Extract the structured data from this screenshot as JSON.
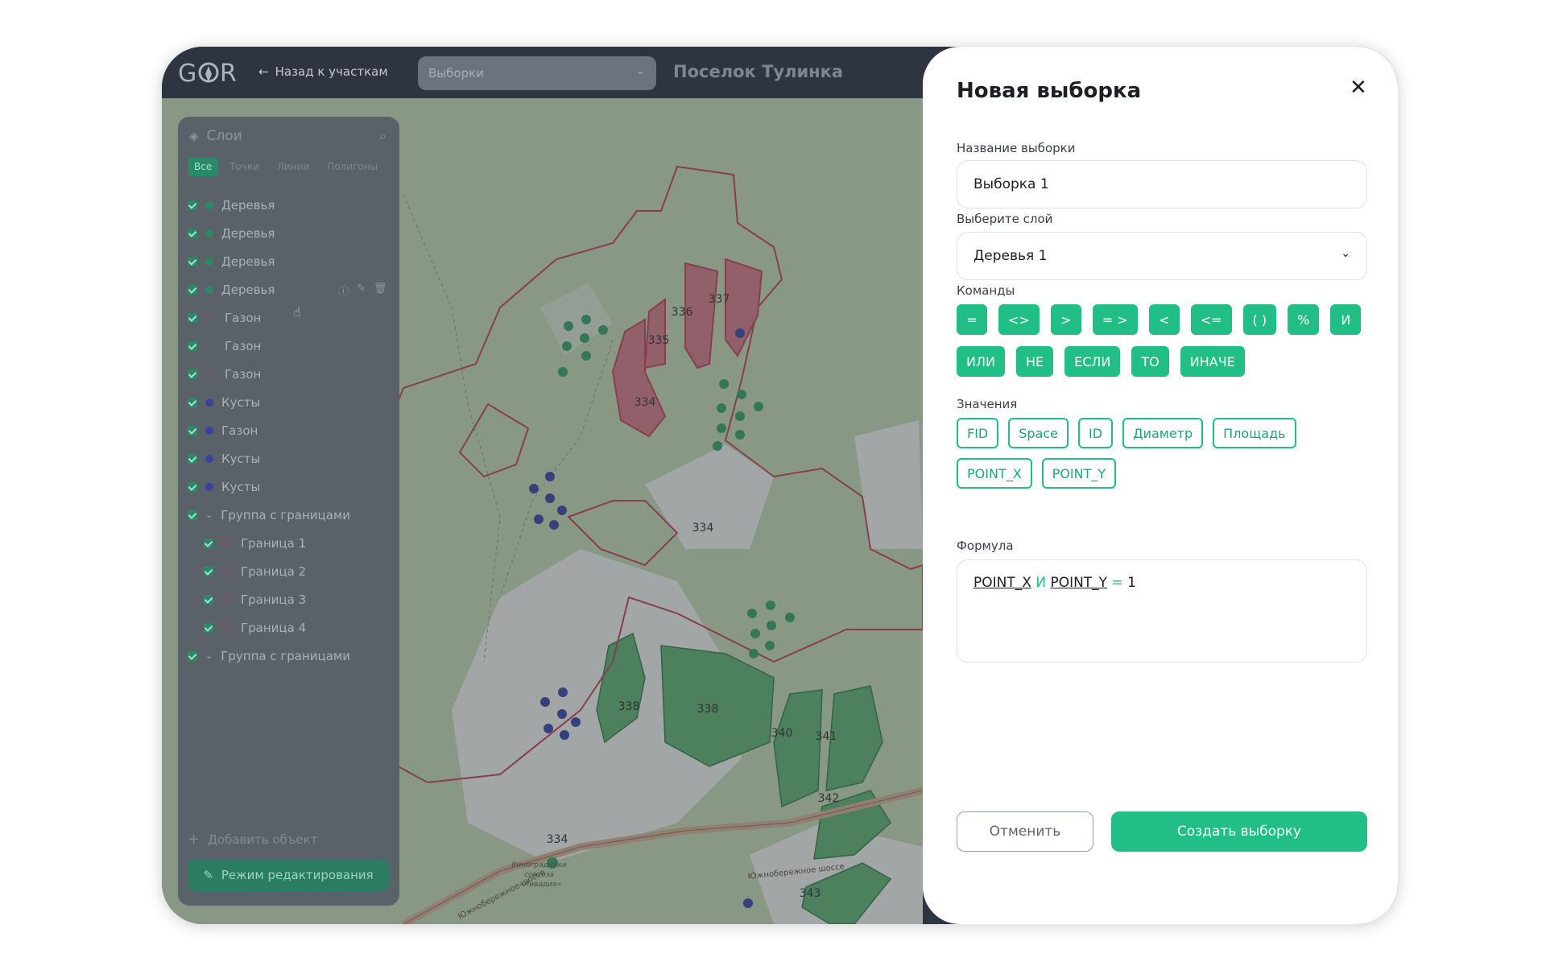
{
  "header": {
    "back_label": "Назад к участкам",
    "selector_value": "Выборки",
    "place_title": "Поселок Тулинка"
  },
  "map": {
    "plot_labels": [
      "337",
      "336",
      "335",
      "334",
      "334",
      "338",
      "338",
      "340",
      "341",
      "342",
      "343",
      "334"
    ],
    "road_label": "Южнобережное шоссе",
    "place_label": "Виноградники совхоза «Ливадия»",
    "road_label_2": "Южнобережное шоссе"
  },
  "layers": {
    "title": "Слои",
    "filters": [
      "Все",
      "Точки",
      "Линии",
      "Полигоны"
    ],
    "items": [
      {
        "label": "Деревья",
        "marker": "green"
      },
      {
        "label": "Деревья",
        "marker": "green"
      },
      {
        "label": "Деревья",
        "marker": "green"
      },
      {
        "label": "Деревья",
        "marker": "green"
      },
      {
        "label": "Газон",
        "marker": "line"
      },
      {
        "label": "Газон",
        "marker": "line"
      },
      {
        "label": "Газон",
        "marker": "line"
      },
      {
        "label": "Кусты",
        "marker": "blue"
      },
      {
        "label": "Газон",
        "marker": "blue"
      },
      {
        "label": "Кусты",
        "marker": "blue"
      },
      {
        "label": "Кусты",
        "marker": "blue"
      },
      {
        "label": "Группа с границами",
        "marker": "group"
      },
      {
        "label": "Граница 1",
        "marker": "poly"
      },
      {
        "label": "Граница 2",
        "marker": "poly"
      },
      {
        "label": "Граница 3",
        "marker": "poly"
      },
      {
        "label": "Граница 4",
        "marker": "poly"
      },
      {
        "label": "Группа с границами",
        "marker": "group"
      }
    ],
    "add_label": "Добавить объект",
    "edit_mode_label": "Режим редактирования"
  },
  "panel": {
    "title": "Новая выборка",
    "name_label": "Название выборки",
    "name_value": "Выборка 1",
    "layer_label": "Выберите слой",
    "layer_value": "Деревья 1",
    "commands_label": "Команды",
    "commands": [
      "=",
      "<>",
      ">",
      "= >",
      "<",
      "<=",
      "( )",
      "%",
      "И",
      "ИЛИ",
      "НЕ",
      "ЕСЛИ",
      "ТО",
      "ИНАЧЕ"
    ],
    "values_label": "Значения",
    "values": [
      "FID",
      "Space",
      "ID",
      "Диаметр",
      "Площадь",
      "POINT_X",
      "POINT_Y"
    ],
    "formula_label": "Формула",
    "formula": {
      "var1": "POINT_X",
      "op1": "И",
      "var2": "POINT_Y",
      "op2": "=",
      "num": "1"
    },
    "cancel_label": "Отменить",
    "create_label": "Создать выборку"
  },
  "colors": {
    "accent": "#21be86",
    "plot_red": "#b5404f",
    "plot_green": "#4caf6f"
  }
}
